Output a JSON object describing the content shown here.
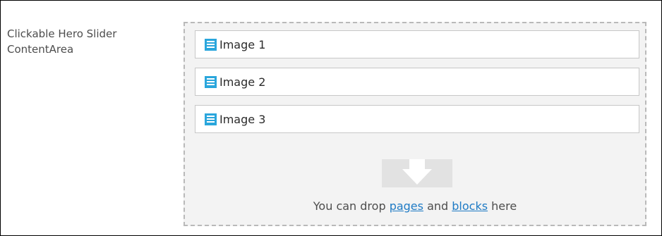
{
  "field": {
    "label": "Clickable Hero Slider ContentArea"
  },
  "content_area": {
    "items": [
      {
        "label": "Image 1",
        "icon": "block-icon"
      },
      {
        "label": "Image 2",
        "icon": "block-icon"
      },
      {
        "label": "Image 3",
        "icon": "block-icon"
      }
    ],
    "drop_hint": {
      "before": "You can drop ",
      "pages_link": "pages",
      "middle": " and ",
      "blocks_link": "blocks",
      "after": " here",
      "icon": "drop-arrow-icon"
    }
  },
  "colors": {
    "block_icon": "#2aa6dc",
    "link": "#1f7bc5",
    "area_background": "#f3f3f3",
    "dashed_border": "#b9b9b9"
  }
}
